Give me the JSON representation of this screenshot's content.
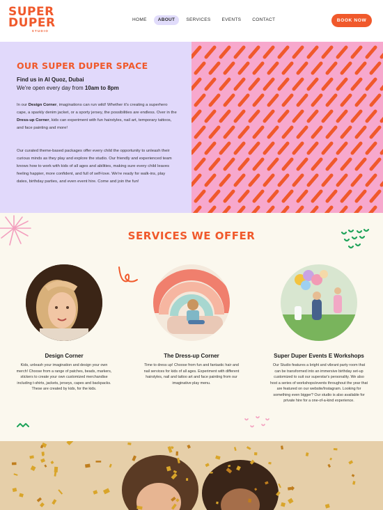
{
  "brand": {
    "line1": "SUPER",
    "line2": "DUPER",
    "line3": "STUDIO"
  },
  "nav": {
    "items": [
      {
        "label": "HOME"
      },
      {
        "label": "ABOUT"
      },
      {
        "label": "SERVICES"
      },
      {
        "label": "EVENTS"
      },
      {
        "label": "CONTACT"
      }
    ],
    "active": "ABOUT",
    "cta": "BOOK NOW"
  },
  "about": {
    "title": "OUR SUPER DUPER SPACE",
    "location": "Find us in Al Quoz, Dubai",
    "hours_prefix": "We're open every day from ",
    "hours_bold": "10am to 8pm",
    "p1": [
      {
        "t": "In our "
      },
      {
        "t": "Design Corner",
        "b": true
      },
      {
        "t": ", imaginations can run wild! Whether it's creating a superhero cape, a sparkly denim jacket, or a sporty  jersey, the possibilities are endless. Over in the "
      },
      {
        "t": "Dress-up Corner",
        "b": true
      },
      {
        "t": ", kids can experiment with fun hairstyles, nail art, temporary tattoos, and face painting and more!"
      }
    ],
    "p2": "Our curated theme-based packages offer every child the opportunity to unleash their curious minds as they play and explore the studio. Our friendly and experienced team knows how to work with kids of all ages and abilities, making sure every child leaves feeling happier, more confident, and full of self-love. We're ready for walk-ins, play dates, birthday parties, and even event hire. Come and join the fun!"
  },
  "services": {
    "title": "SERVICES WE OFFER",
    "items": [
      {
        "title": "Design Corner",
        "text": "Kids, unleash your imagination and design your own merch! Choose from a range of patches, beads, markers, stickers to create your own customized merchandise including t-shirts, jackets, jerseys, capes and backpacks. These are created by kids, for the kids."
      },
      {
        "title": "The Dress-up Corner",
        "text": "Time to dress up! Choose from fun and fantastic hair and nail services for kids of all ages. Experiment with different hairstyles, nail and tattoo art and face painting from our imaginative play menu."
      },
      {
        "title": "Super Duper Events E Workshops",
        "text": "Our Studio features a bright and vibrant party room that can be transformed into an immersive birthday set-up customized to suit our superstar's personality. We also host a series of workshops/events throughout the year that are featured on our website/Instagram. Looking for something even bigger? Our studio is also available for private hire for a one-of-a-kind experience."
      }
    ]
  },
  "colors": {
    "accent": "#f0592b",
    "lavender": "#e1d9fb",
    "pink": "#f7a8cd",
    "cream": "#fbf8ee",
    "green": "#1fa35a"
  },
  "icons": [
    "sparkle-burst-icon",
    "squiggle-icon",
    "green-sprout-icon",
    "zigzag-icon",
    "pink-dots-icon"
  ]
}
